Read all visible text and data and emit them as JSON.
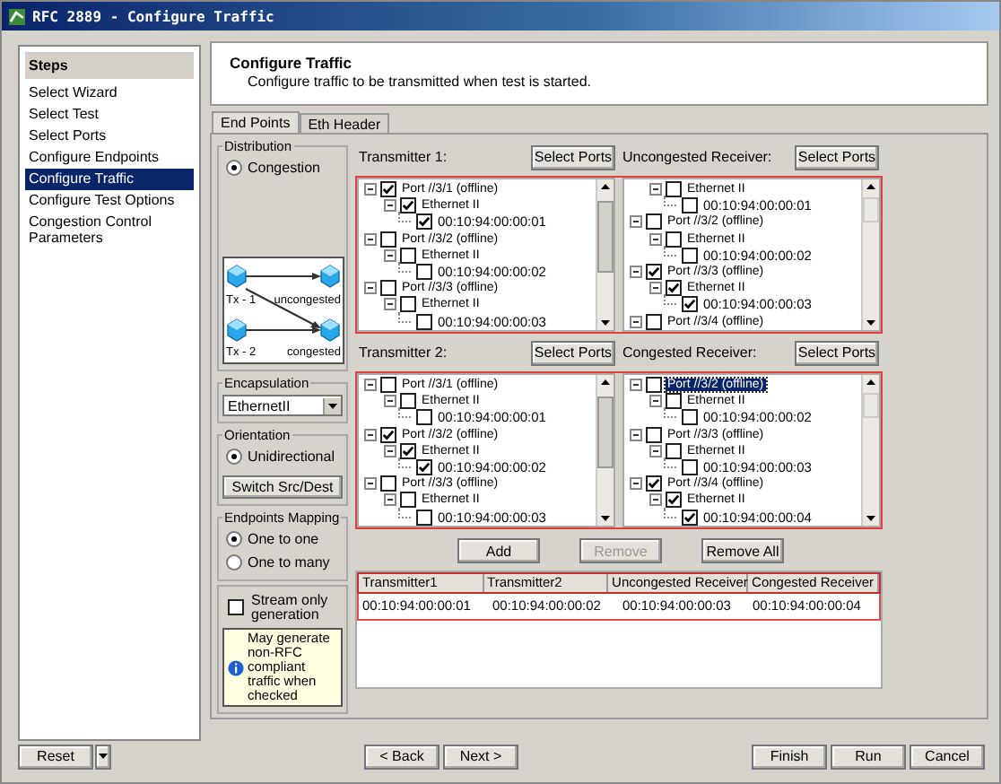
{
  "window": {
    "title": "RFC 2889 - Configure Traffic"
  },
  "steps": {
    "title": "Steps",
    "items": [
      {
        "label": "Select Wizard",
        "selected": false
      },
      {
        "label": "Select Test",
        "selected": false
      },
      {
        "label": "Select Ports",
        "selected": false
      },
      {
        "label": "Configure Endpoints",
        "selected": false
      },
      {
        "label": "Configure Traffic",
        "selected": true
      },
      {
        "label": "Configure Test Options",
        "selected": false
      },
      {
        "label": "Congestion Control Parameters",
        "selected": false
      }
    ]
  },
  "header": {
    "title": "Configure Traffic",
    "subtitle": "Configure traffic to be transmitted when test is started."
  },
  "tabs": [
    {
      "label": "End Points",
      "selected": true
    },
    {
      "label": "Eth Header",
      "selected": false
    }
  ],
  "distribution": {
    "title": "Distribution",
    "options": [
      {
        "label": "Congestion",
        "selected": true
      }
    ],
    "diagram_labels": [
      "Tx - 1",
      "uncongested",
      "Tx - 2",
      "congested"
    ]
  },
  "encapsulation": {
    "title": "Encapsulation",
    "value": "EthernetII"
  },
  "orientation": {
    "title": "Orientation",
    "options": [
      {
        "label": "Unidirectional",
        "selected": true
      }
    ],
    "button": "Switch Src/Dest"
  },
  "endpoints_mapping": {
    "title": "Endpoints Mapping",
    "options": [
      {
        "label": "One to one",
        "selected": true
      },
      {
        "label": "One to many",
        "selected": false
      }
    ]
  },
  "stream_only": {
    "label": "Stream only generation",
    "checked": false,
    "note": "May generate non-RFC compliant traffic when checked"
  },
  "endpoint_panels": [
    {
      "title": "Transmitter 1:",
      "button": "Select Ports",
      "tree": [
        {
          "kind": "port",
          "text": "Port //3/1 (offline)",
          "checked": true,
          "selected": false,
          "children": [
            {
              "kind": "ethernet",
              "text": "Ethernet II",
              "checked": true,
              "children": [
                {
                  "kind": "mac",
                  "text": "00:10:94:00:00:01",
                  "checked": true
                }
              ]
            }
          ]
        },
        {
          "kind": "port",
          "text": "Port //3/2 (offline)",
          "checked": false,
          "selected": false,
          "children": [
            {
              "kind": "ethernet",
              "text": "Ethernet II",
              "checked": false,
              "children": [
                {
                  "kind": "mac",
                  "text": "00:10:94:00:00:02",
                  "checked": false
                }
              ]
            }
          ]
        },
        {
          "kind": "port",
          "text": "Port //3/3 (offline)",
          "checked": false,
          "selected": false,
          "children": [
            {
              "kind": "ethernet",
              "text": "Ethernet II",
              "checked": false,
              "children": [
                {
                  "kind": "mac",
                  "text": "00:10:94:00:00:03",
                  "checked": false
                }
              ]
            }
          ]
        }
      ]
    },
    {
      "title": "Uncongested Receiver:",
      "button": "Select Ports",
      "tree": [
        {
          "kind": "ethernet",
          "text": "Ethernet II",
          "checked": false,
          "selected": false,
          "children": [
            {
              "kind": "mac",
              "text": "00:10:94:00:00:01",
              "checked": false
            }
          ]
        },
        {
          "kind": "port",
          "text": "Port //3/2 (offline)",
          "checked": false,
          "selected": false,
          "children": [
            {
              "kind": "ethernet",
              "text": "Ethernet II",
              "checked": false,
              "children": [
                {
                  "kind": "mac",
                  "text": "00:10:94:00:00:02",
                  "checked": false
                }
              ]
            }
          ]
        },
        {
          "kind": "port",
          "text": "Port //3/3 (offline)",
          "checked": true,
          "selected": false,
          "children": [
            {
              "kind": "ethernet",
              "text": "Ethernet II",
              "checked": true,
              "children": [
                {
                  "kind": "mac",
                  "text": "00:10:94:00:00:03",
                  "checked": true
                }
              ]
            }
          ]
        },
        {
          "kind": "port",
          "text": "Port //3/4 (offline)",
          "checked": false,
          "selected": false
        }
      ]
    },
    {
      "title": "Transmitter 2:",
      "button": "Select Ports",
      "tree": [
        {
          "kind": "port",
          "text": "Port //3/1 (offline)",
          "checked": false,
          "selected": false,
          "children": [
            {
              "kind": "ethernet",
              "text": "Ethernet II",
              "checked": false,
              "children": [
                {
                  "kind": "mac",
                  "text": "00:10:94:00:00:01",
                  "checked": false
                }
              ]
            }
          ]
        },
        {
          "kind": "port",
          "text": "Port //3/2 (offline)",
          "checked": true,
          "selected": false,
          "children": [
            {
              "kind": "ethernet",
              "text": "Ethernet II",
              "checked": true,
              "children": [
                {
                  "kind": "mac",
                  "text": "00:10:94:00:00:02",
                  "checked": true
                }
              ]
            }
          ]
        },
        {
          "kind": "port",
          "text": "Port //3/3 (offline)",
          "checked": false,
          "selected": false,
          "children": [
            {
              "kind": "ethernet",
              "text": "Ethernet II",
              "checked": false,
              "children": [
                {
                  "kind": "mac",
                  "text": "00:10:94:00:00:03",
                  "checked": false
                }
              ]
            }
          ]
        }
      ]
    },
    {
      "title": "Congested Receiver:",
      "button": "Select Ports",
      "tree": [
        {
          "kind": "port",
          "text": "Port //3/2 (offline)",
          "checked": false,
          "selected": true,
          "children": [
            {
              "kind": "ethernet",
              "text": "Ethernet II",
              "checked": false,
              "children": [
                {
                  "kind": "mac",
                  "text": "00:10:94:00:00:02",
                  "checked": false
                }
              ]
            }
          ]
        },
        {
          "kind": "port",
          "text": "Port //3/3 (offline)",
          "checked": false,
          "selected": false,
          "children": [
            {
              "kind": "ethernet",
              "text": "Ethernet II",
              "checked": false,
              "children": [
                {
                  "kind": "mac",
                  "text": "00:10:94:00:00:03",
                  "checked": false
                }
              ]
            }
          ]
        },
        {
          "kind": "port",
          "text": "Port //3/4 (offline)",
          "checked": true,
          "selected": false,
          "children": [
            {
              "kind": "ethernet",
              "text": "Ethernet II",
              "checked": true,
              "children": [
                {
                  "kind": "mac",
                  "text": "00:10:94:00:00:04",
                  "checked": true
                }
              ]
            }
          ]
        }
      ]
    }
  ],
  "actions": [
    {
      "label": "Add",
      "disabled": false
    },
    {
      "label": "Remove",
      "disabled": true
    },
    {
      "label": "Remove All",
      "disabled": false
    }
  ],
  "table": {
    "columns": [
      "Transmitter1",
      "Transmitter2",
      "Uncongested Receiver",
      "Congested Receiver"
    ],
    "rows": [
      [
        "00:10:94:00:00:01",
        "00:10:94:00:00:02",
        "00:10:94:00:00:03",
        "00:10:94:00:00:04"
      ]
    ]
  },
  "footer": {
    "reset": "Reset",
    "nav_buttons": [
      "< Back",
      "Next >"
    ],
    "end_buttons": [
      "Finish",
      "Run",
      "Cancel"
    ]
  }
}
